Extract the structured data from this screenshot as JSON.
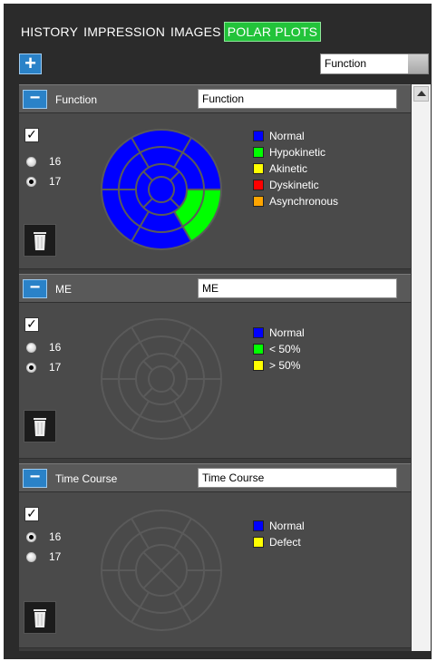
{
  "tabs": [
    {
      "label": "HISTORY",
      "active": false
    },
    {
      "label": "IMPRESSION",
      "active": false
    },
    {
      "label": "IMAGES",
      "active": false
    },
    {
      "label": "POLAR PLOTS",
      "active": true
    }
  ],
  "toolbar": {
    "add_label": "+",
    "select_value": "Function"
  },
  "panels": [
    {
      "title": "Function",
      "name_value": "Function",
      "checked": true,
      "radios": [
        {
          "label": "16",
          "selected": false
        },
        {
          "label": "17",
          "selected": true
        }
      ],
      "segment_model": 17,
      "legend": [
        {
          "label": "Normal",
          "color": "#0000ff"
        },
        {
          "label": "Hypokinetic",
          "color": "#00ff00"
        },
        {
          "label": "Akinetic",
          "color": "#ffff00"
        },
        {
          "label": "Dyskinetic",
          "color": "#ff0000"
        },
        {
          "label": "Asynchronous",
          "color": "#ffa500"
        }
      ]
    },
    {
      "title": "ME",
      "name_value": "ME",
      "checked": true,
      "radios": [
        {
          "label": "16",
          "selected": false
        },
        {
          "label": "17",
          "selected": true
        }
      ],
      "segment_model": 17,
      "legend": [
        {
          "label": "Normal",
          "color": "#0000ff"
        },
        {
          "label": "< 50%",
          "color": "#00ff00"
        },
        {
          "label": "> 50%",
          "color": "#ffff00"
        }
      ]
    },
    {
      "title": "Time Course",
      "name_value": "Time Course",
      "checked": true,
      "radios": [
        {
          "label": "16",
          "selected": true
        },
        {
          "label": "17",
          "selected": false
        }
      ],
      "segment_model": 16,
      "legend": [
        {
          "label": "Normal",
          "color": "#0000ff"
        },
        {
          "label": "Defect",
          "color": "#ffff00"
        }
      ]
    }
  ],
  "colors": {
    "accent_blue": "#2a82c8",
    "active_tab": "#22c33a",
    "plot_fill_normal": "#0000ff",
    "plot_fill_hypokinetic": "#00ff00",
    "plot_line": "#5a5a5a"
  }
}
